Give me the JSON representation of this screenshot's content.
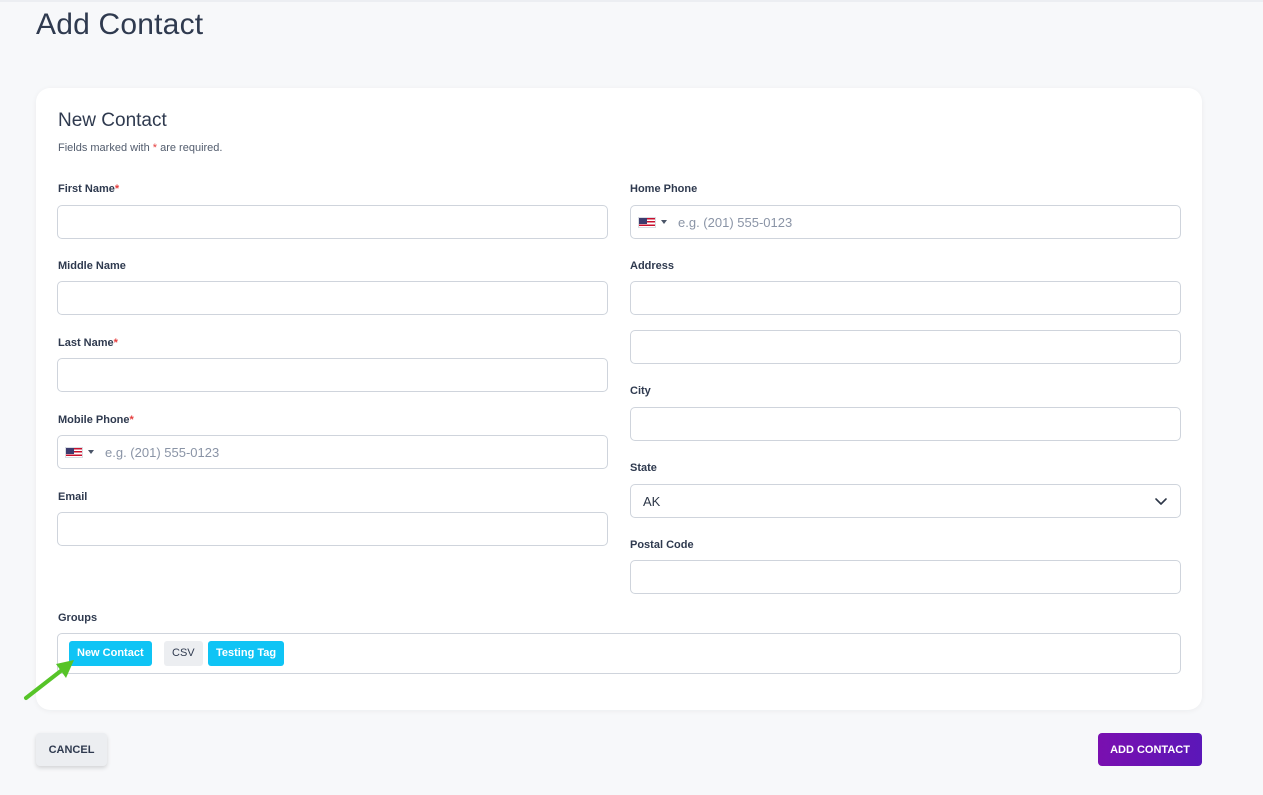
{
  "page": {
    "title": "Add Contact"
  },
  "card": {
    "title": "New Contact",
    "note_prefix": "Fields marked with ",
    "note_star": "*",
    "note_suffix": " are required."
  },
  "fields": {
    "first_name": {
      "label": "First Name",
      "required_mark": "*",
      "value": ""
    },
    "middle_name": {
      "label": "Middle Name",
      "value": ""
    },
    "last_name": {
      "label": "Last Name",
      "required_mark": "*",
      "value": ""
    },
    "mobile_phone": {
      "label": "Mobile Phone",
      "required_mark": "*",
      "placeholder": "e.g. (201) 555-0123",
      "country_icon": "us-flag-icon"
    },
    "email": {
      "label": "Email",
      "value": ""
    },
    "home_phone": {
      "label": "Home Phone",
      "placeholder": "e.g. (201) 555-0123",
      "country_icon": "us-flag-icon"
    },
    "address": {
      "label": "Address",
      "line1": "",
      "line2": ""
    },
    "city": {
      "label": "City",
      "value": ""
    },
    "state": {
      "label": "State",
      "value": "AK"
    },
    "postal_code": {
      "label": "Postal Code",
      "value": ""
    }
  },
  "groups": {
    "label": "Groups",
    "tags": [
      {
        "label": "New Contact",
        "style": "cyan"
      },
      {
        "label": "CSV",
        "style": "gray"
      },
      {
        "label": "Testing Tag",
        "style": "cyan"
      }
    ]
  },
  "actions": {
    "cancel_label": "CANCEL",
    "add_label": "ADD CONTACT"
  },
  "colors": {
    "accent_cyan": "#0fc4f5",
    "primary_purple": "#6a12b4",
    "required_red": "#e53e3e",
    "annotation_arrow": "#56c428"
  }
}
